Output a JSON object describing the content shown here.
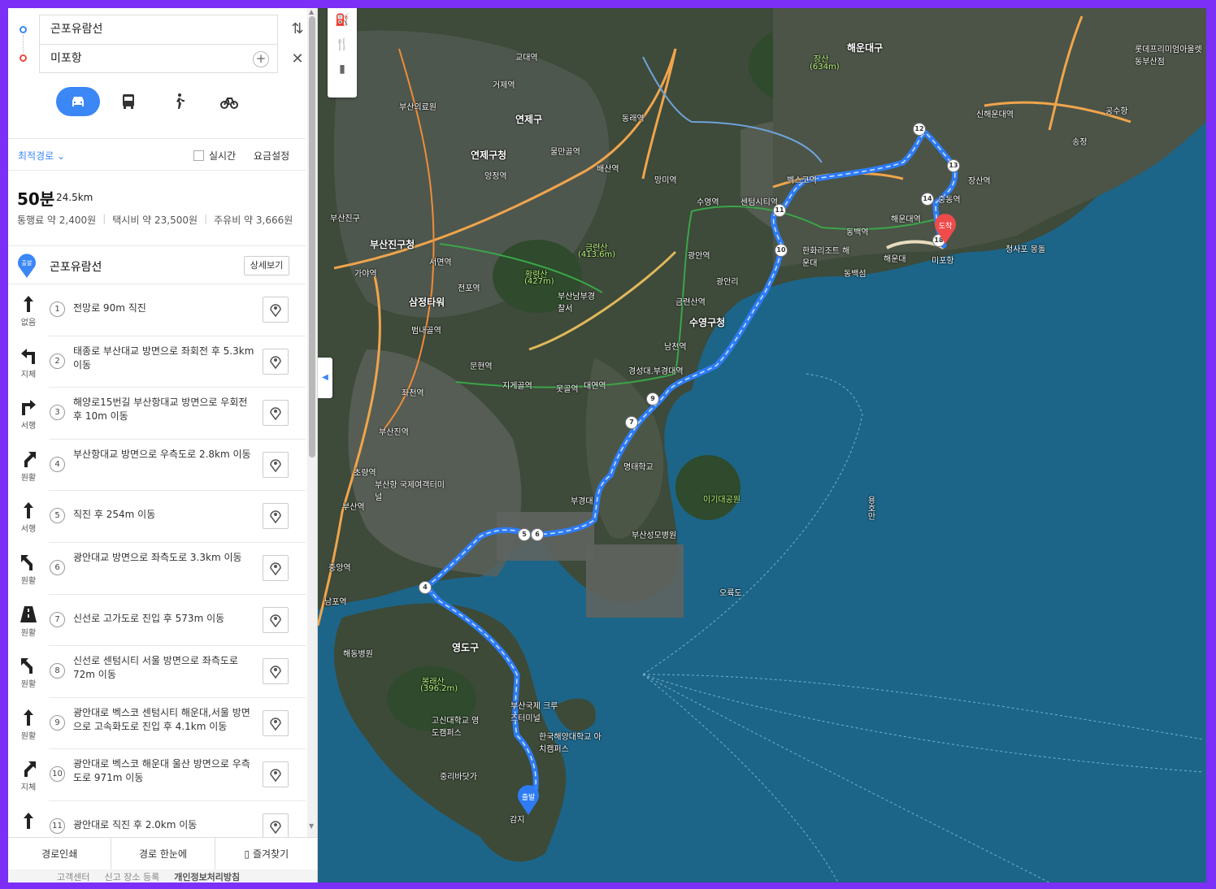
{
  "search": {
    "origin": "곤포유람선",
    "destination": "미포항"
  },
  "modes": [
    "car",
    "transit",
    "walk",
    "bicycle"
  ],
  "options": {
    "route_type": "최적경로",
    "realtime_label": "실시간",
    "fee_label": "요금설정"
  },
  "summary": {
    "time": "50분",
    "distance": "24.5km",
    "toll": "통행료 약 2,400원",
    "taxi": "택시비 약 23,500원",
    "fuel": "주유비 약 3,666원"
  },
  "start": {
    "badge": "출발",
    "name": "곤포유람선",
    "detail_label": "상세보기"
  },
  "steps": [
    {
      "num": "1",
      "icon": "arrow-up-icon",
      "road": "없음",
      "text": "전망로 90m 직진"
    },
    {
      "num": "2",
      "icon": "turn-left-icon",
      "road": "지체",
      "text": "태종로 부산대교 방면으로 좌회전 후 5.3km 이동"
    },
    {
      "num": "3",
      "icon": "turn-right-icon",
      "road": "서행",
      "text": "해양로15번길 부산항대교 방면으로 우회전 후 10m 이동"
    },
    {
      "num": "4",
      "icon": "slight-right-icon",
      "road": "원활",
      "text": "부산항대교 방면으로 우측도로 2.8km 이동"
    },
    {
      "num": "5",
      "icon": "arrow-up-icon",
      "road": "서행",
      "text": "직진 후 254m 이동"
    },
    {
      "num": "6",
      "icon": "slight-left-icon",
      "road": "원활",
      "text": "광안대교 방면으로 좌측도로 3.3km 이동"
    },
    {
      "num": "7",
      "icon": "highway-icon",
      "road": "원활",
      "text": "신선로 고가도로 진입 후 573m 이동"
    },
    {
      "num": "8",
      "icon": "slight-left-icon",
      "road": "원활",
      "text": "신선로 센텀시티 서울 방면으로 좌측도로 72m 이동"
    },
    {
      "num": "9",
      "icon": "arrow-up-icon",
      "road": "원활",
      "text": "광안대로 벡스코 센텀시티 해운대,서울 방면으로 고속화도로 진입 후 4.1km 이동"
    },
    {
      "num": "10",
      "icon": "slight-right-icon",
      "road": "지체",
      "text": "광안대로 벡스코 해운대 울산 방면으로 우측도로 971m 이동"
    },
    {
      "num": "11",
      "icon": "arrow-up-icon",
      "road": "",
      "text": "광안대로 직진 후 2.0km 이동"
    }
  ],
  "bottom_actions": {
    "print": "경로인쇄",
    "overview": "경로 한눈에",
    "favorite": "즐겨찾기"
  },
  "footer": {
    "center": "고객센터",
    "report": "신고 장소 등록",
    "privacy": "개인정보처리방침"
  },
  "map": {
    "end_badge": "도착",
    "start_badge": "출발",
    "waypoints": [
      "4",
      "5",
      "6",
      "7",
      "9",
      "10",
      "11",
      "12",
      "13",
      "14",
      "18"
    ],
    "labels": {
      "l1": "부산의료원",
      "l2": "연제구청",
      "l3": "연제구",
      "l4": "부산진구청",
      "l5": "부산진구",
      "l6": "서면역",
      "l7": "전포역",
      "l8": "삼정타워",
      "l9": "범내골역",
      "l10": "부산진역",
      "l11": "문현역",
      "l12": "지게골역",
      "l13": "못골역",
      "l14": "대연역",
      "l15": "경성대.부경대역",
      "l16": "남천역",
      "l17": "금련산역",
      "l18": "광안역",
      "l19": "수영구청",
      "l20": "수영역",
      "l21": "황령산",
      "l22": "(427m)",
      "l23": "금련산",
      "l24": "(413.6m)",
      "l25": "부산남부경찰서",
      "l26": "장산",
      "l27": "(634m)",
      "l28": "해운대구",
      "l29": "센텀시티역",
      "l30": "벡스코역",
      "l31": "동백역",
      "l32": "해운대역",
      "l33": "중동역",
      "l34": "장산역",
      "l35": "신해운대역",
      "l36": "해운대",
      "l37": "미포항",
      "l38": "청사포 몽돌",
      "l39": "동백섬",
      "l40": "송정",
      "l41": "공수항",
      "l42": "롯데프리미엄아울렛 동부산점",
      "l43": "이기대공원",
      "l44": "오륙도",
      "l45": "부산항 국제여객터미널",
      "l46": "영도구",
      "l47": "봉래산",
      "l48": "(396.2m)",
      "l49": "고신대학교 영도캠퍼스",
      "l50": "한국해양대학교 아치캠퍼스",
      "l51": "부산국제 크루즈터미널",
      "l52": "중리바닷가",
      "l53": "감지",
      "l54": "해동병원",
      "l55": "남포역",
      "l56": "중앙역",
      "l57": "초량역",
      "l58": "부산역",
      "l59": "좌천역",
      "l60": "가야역",
      "l61": "거제역",
      "l62": "교대역",
      "l63": "동래역",
      "l64": "망미역",
      "l65": "배산역",
      "l66": "물만골역",
      "l67": "양정역",
      "l68": "부산성모병원",
      "l69": "용호만",
      "l70": "광안리",
      "l71": "한화리조트 해운대",
      "l72": "부경대",
      "l73": "명태학교"
    }
  },
  "colors": {
    "accent": "#3b87f5",
    "end_pin": "#ef4b4b",
    "sea": "#1c6588",
    "land": "#3e4a3a",
    "frame": "#7b2ff7"
  }
}
